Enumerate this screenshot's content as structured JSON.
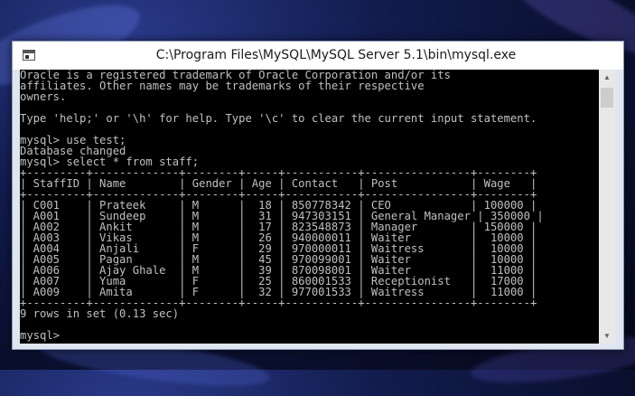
{
  "window": {
    "title": "C:\\Program Files\\MySQL\\MySQL Server 5.1\\bin\\mysql.exe",
    "icon": "console-window-icon"
  },
  "console": {
    "lines": [
      "Oracle is a registered trademark of Oracle Corporation and/or its",
      "affiliates. Other names may be trademarks of their respective",
      "owners.",
      "",
      "Type 'help;' or '\\h' for help. Type '\\c' to clear the current input statement.",
      "",
      "mysql> use test;",
      "Database changed",
      "mysql> select * from staff;",
      "+---------+-------------+--------+-----+-----------+----------------+--------+",
      "| StaffID | Name        | Gender | Age | Contact   | Post           | Wage   |",
      "+---------+-------------+--------+-----+-----------+----------------+--------+",
      "| C001    | Prateek     | M      |  18 | 850778342 | CEO            | 100000 |",
      "| A001    | Sundeep     | M      |  31 | 947303151 | General Manager | 350000 |",
      "| A002    | Ankit       | M      |  17 | 823548873 | Manager        | 150000 |",
      "| A003    | Vikas       | M      |  26 | 940000011 | Waiter         |  10000 |",
      "| A004    | Anjali      | F      |  29 | 970000011 | Waitress       |  10000 |",
      "| A005    | Pagan       | M      |  45 | 970099001 | Waiter         |  10000 |",
      "| A006    | Ajay Ghale  | M      |  39 | 870098001 | Waiter         |  11000 |",
      "| A007    | Yuma        | F      |  25 | 860001533 | Receptionist   |  17000 |",
      "| A009    | Amita       | F      |  32 | 977001533 | Waitress       |  11000 |",
      "+---------+-------------+--------+-----+-----------+----------------+--------+",
      "9 rows in set (0.13 sec)",
      "",
      "mysql>"
    ]
  },
  "scrollbar": {
    "up_icon": "scroll-up-arrow-icon",
    "down_icon": "scroll-down-arrow-icon",
    "up_glyph": "▲",
    "down_glyph": "▼"
  }
}
